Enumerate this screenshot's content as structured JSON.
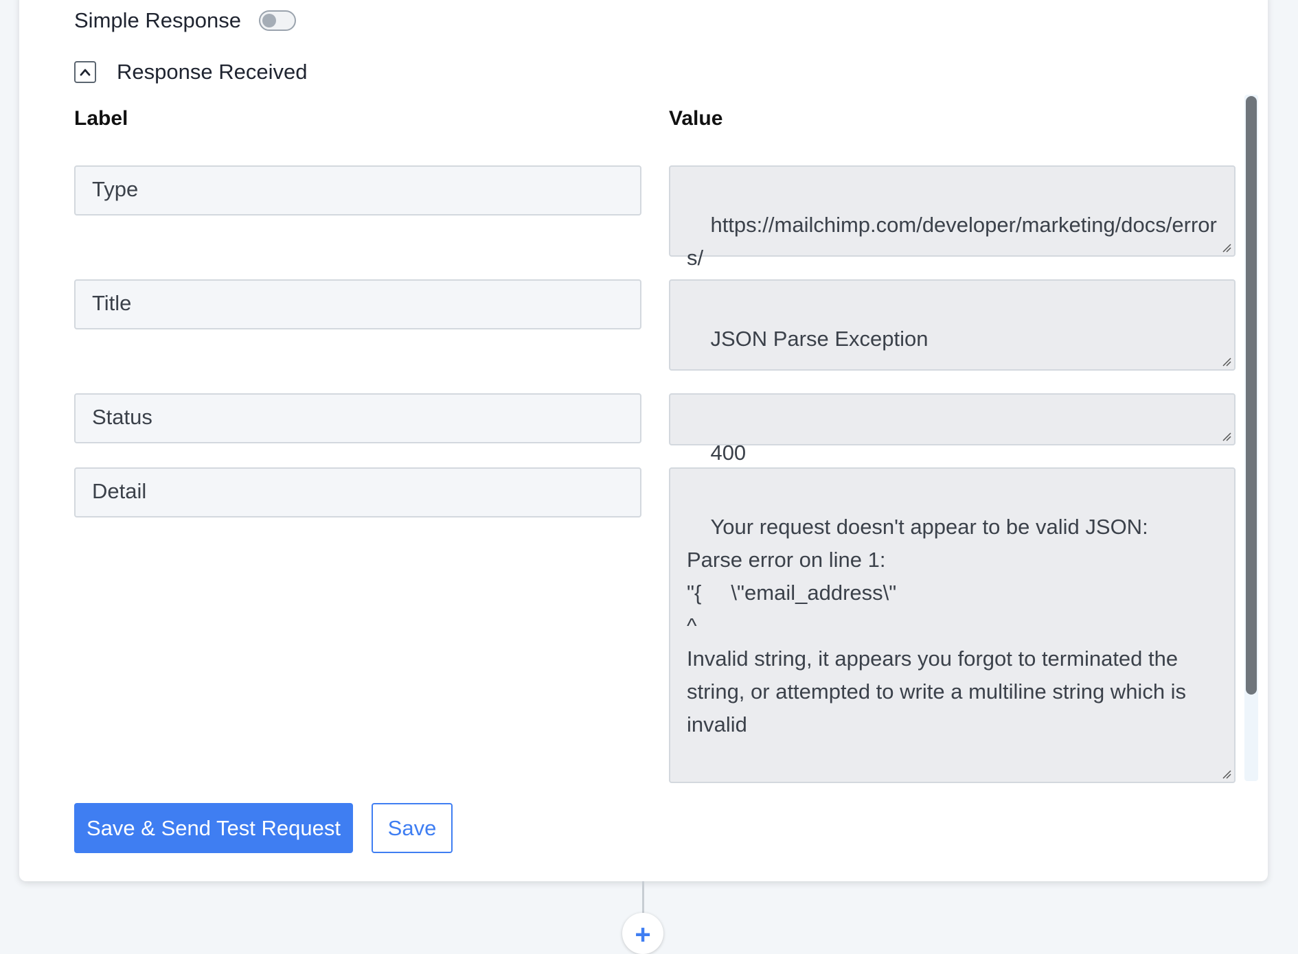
{
  "simple_response": {
    "label": "Simple Response",
    "enabled": false
  },
  "response_received": {
    "label": "Response Received",
    "expanded": true,
    "toggle_icon": "chevron-up-icon"
  },
  "table": {
    "label_header": "Label",
    "value_header": "Value",
    "rows": [
      {
        "label": "Type",
        "value": "https://mailchimp.com/developer/marketing/docs/errors/"
      },
      {
        "label": "Title",
        "value": "JSON Parse Exception"
      },
      {
        "label": "Status",
        "value": "400"
      },
      {
        "label": "Detail",
        "value": "Your request doesn't appear to be valid JSON:\nParse error on line 1:\n\"{     \\\"email_address\\\"\n^\nInvalid string, it appears you forgot to terminated the string, or attempted to write a multiline string which is invalid"
      }
    ]
  },
  "actions": {
    "save_send_label": "Save & Send Test Request",
    "save_label": "Save"
  },
  "add_step": {
    "icon": "plus-icon",
    "glyph": "+"
  },
  "colors": {
    "accent": "#3f7ef2",
    "label_field_bg": "#f4f6f9",
    "value_field_bg": "#ebecef",
    "page_bg": "#f3f6f9"
  }
}
